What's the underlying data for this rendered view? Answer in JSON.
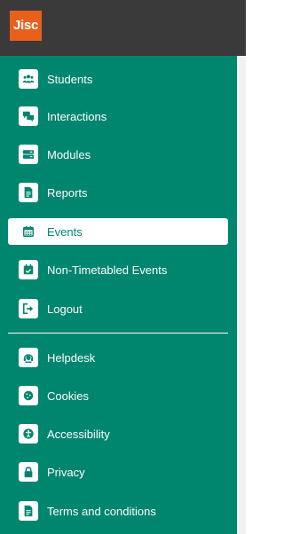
{
  "app": {
    "logo_text": "Jisc",
    "brand_color": "#e8601c",
    "panel_color": "#00856f",
    "topbar_color": "#3a3a3a"
  },
  "nav": {
    "main_items": [
      {
        "label": "Students",
        "icon": "users-icon"
      },
      {
        "label": "Interactions",
        "icon": "chat-bubbles-icon"
      },
      {
        "label": "Modules",
        "icon": "modules-icon"
      },
      {
        "label": "Reports",
        "icon": "document-icon"
      },
      {
        "label": "Events",
        "icon": "calendar-icon",
        "active": true
      },
      {
        "label": "Non-Timetabled Events",
        "icon": "calendar-check-icon"
      },
      {
        "label": "Logout",
        "icon": "logout-icon"
      }
    ],
    "secondary_items": [
      {
        "label": "Helpdesk",
        "icon": "headset-icon"
      },
      {
        "label": "Cookies",
        "icon": "cookie-icon"
      },
      {
        "label": "Accessibility",
        "icon": "accessibility-icon"
      },
      {
        "label": "Privacy",
        "icon": "lock-icon"
      },
      {
        "label": "Terms and conditions",
        "icon": "document-icon"
      }
    ]
  }
}
